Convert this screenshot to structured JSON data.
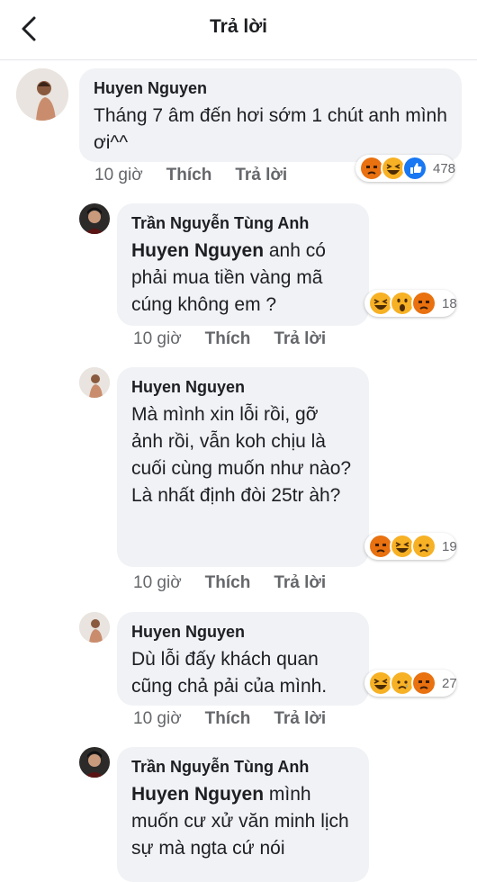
{
  "header": {
    "title": "Trả lời"
  },
  "comments": [
    {
      "author": "Huyen Nguyen",
      "text": "Tháng 7 âm đến hơi sớm 1 chút anh mình ơi^^",
      "time": "10 giờ",
      "like": "Thích",
      "reply": "Trả lời",
      "reactions": [
        "angry-icon",
        "haha-icon",
        "like-icon"
      ],
      "count": "478"
    },
    {
      "author": "Trần Nguyễn Tùng Anh",
      "mention": "Huyen Nguyen",
      "text": " anh có phải mua tiền vàng mã cúng không em ?",
      "time": "10 giờ",
      "like": "Thích",
      "reply": "Trả lời",
      "reactions": [
        "haha-icon",
        "wow-icon",
        "angry-icon"
      ],
      "count": "18"
    },
    {
      "author": "Huyen Nguyen",
      "text": "Mà mình xin lỗi rồi, gỡ ảnh rồi, vẫn koh chịu là cuối cùng muốn như nào?",
      "text2": "Là nhất định đòi 25tr àh?",
      "time": "10 giờ",
      "like": "Thích",
      "reply": "Trả lời",
      "reactions": [
        "angry-icon",
        "haha-icon",
        "sad-icon"
      ],
      "count": "19"
    },
    {
      "author": "Huyen Nguyen",
      "text": "Dù lỗi đấy khách quan cũng chả pải của mình.",
      "time": "10 giờ",
      "like": "Thích",
      "reply": "Trả lời",
      "reactions": [
        "haha-icon",
        "sad-icon",
        "angry-icon"
      ],
      "count": "27"
    },
    {
      "author": "Trần Nguyễn Tùng Anh",
      "mention": "Huyen Nguyen",
      "text": " mình muốn cư xử văn minh lịch sự mà ngta cứ nói"
    }
  ],
  "colors": {
    "like_blue": "#1877f2",
    "emoji_yellow": "#f7b125",
    "angry_orange": "#e9710f"
  }
}
